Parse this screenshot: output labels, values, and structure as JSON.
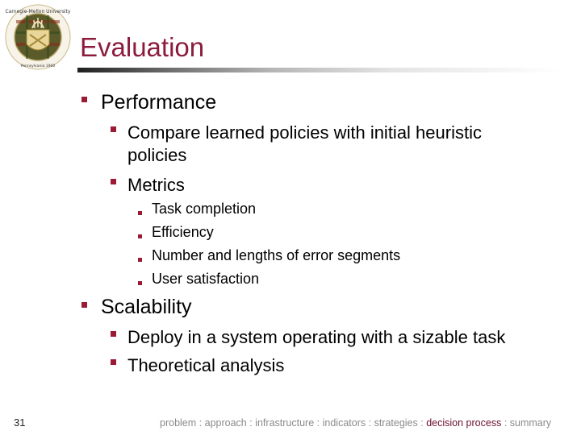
{
  "header": {
    "logo": "carnegie-mellon-university-seal",
    "logo_text_top": "Carnegie-Mellon University",
    "logo_text_bottom": "Pennsylvania 1900",
    "title": "Evaluation"
  },
  "content": {
    "items": [
      {
        "label": "Performance",
        "children": [
          {
            "label_line1": "Compare learned policies with initial heuristic",
            "label_line2": "policies"
          },
          {
            "label": "Metrics",
            "children": [
              {
                "label": "Task completion"
              },
              {
                "label": "Efficiency"
              },
              {
                "label": "Number and lengths of error segments"
              },
              {
                "label": "User satisfaction"
              }
            ]
          }
        ]
      },
      {
        "label": "Scalability",
        "children": [
          {
            "label": "Deploy in a system operating with a sizable task"
          },
          {
            "label": "Theoretical analysis"
          }
        ]
      }
    ]
  },
  "footer": {
    "page_number": "31",
    "separator": ":",
    "nav": [
      {
        "label": "problem",
        "active": false
      },
      {
        "label": "approach",
        "active": false
      },
      {
        "label": "infrastructure",
        "active": false
      },
      {
        "label": "indicators",
        "active": false
      },
      {
        "label": "strategies",
        "active": false
      },
      {
        "label": "decision process",
        "active": true
      },
      {
        "label": "summary",
        "active": false
      }
    ]
  },
  "colors": {
    "title": "#8c1c3c",
    "bullet": "#9b1b35",
    "footer_text": "#8a8a8a",
    "footer_active": "#6b0f2e"
  }
}
